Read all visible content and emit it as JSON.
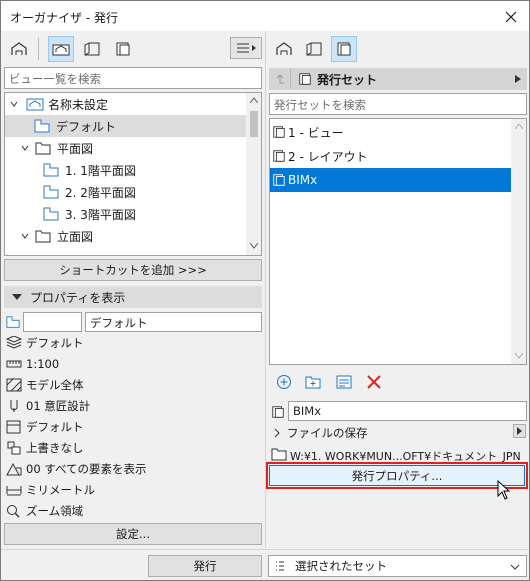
{
  "window": {
    "title": "オーガナイザ - 発行",
    "close": "×"
  },
  "left": {
    "search_placeholder": "ビュー一覧を検索",
    "tree": [
      {
        "label": "名称未設定"
      },
      {
        "label": "デフォルト"
      },
      {
        "label": "平面図"
      },
      {
        "label": "1. 1階平面図"
      },
      {
        "label": "2. 2階平面図"
      },
      {
        "label": "3. 3階平面図"
      },
      {
        "label": "立面図"
      }
    ],
    "add_shortcut": "ショートカットを追加 >>>",
    "props_header": "プロパティを表示",
    "id_value": "",
    "name_value": "デフォルト",
    "props": [
      "デフォルト",
      "1:100",
      "モデル全体",
      "01 意匠設計",
      "デフォルト",
      "上書きなし",
      "00 すべての要素を表示",
      "ミリメートル",
      "ズーム領域"
    ],
    "settings_btn": "設定..."
  },
  "right": {
    "header": "発行セット",
    "search_placeholder": "発行セットを検索",
    "items": [
      "1 - ビュー",
      "2 - レイアウト",
      "BIMx"
    ],
    "name_value": "BIMx",
    "save_label": "ファイルの保存",
    "path": "W:¥1. WORK¥MUN...OFT¥ドキュメント_JPN",
    "props_btn": "発行プロパティ...",
    "highlight_color": "#e0201e",
    "selection_color": "#0078d7"
  },
  "bottom": {
    "publish_btn": "発行",
    "dropdown_value": "選択されたセット"
  }
}
